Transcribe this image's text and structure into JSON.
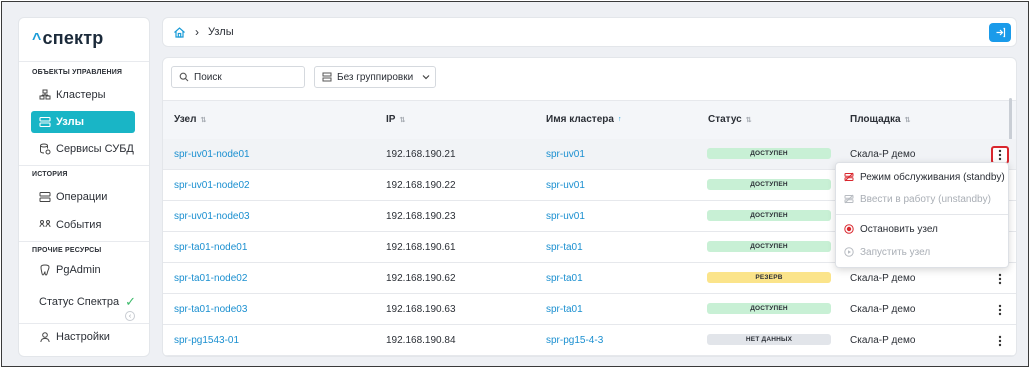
{
  "app": {
    "logo_text": "спектр"
  },
  "sidebar": {
    "section_manage": "ОБЪЕКТЫ УПРАВЛЕНИЯ",
    "section_history": "ИСТОРИЯ",
    "section_other": "ПРОЧИЕ РЕСУРСЫ",
    "items": [
      {
        "label": "Кластеры",
        "icon": "clusters-icon"
      },
      {
        "label": "Узлы",
        "icon": "nodes-icon",
        "active": true
      },
      {
        "label": "Сервисы СУБД",
        "icon": "db-services-icon"
      },
      {
        "label": "Операции",
        "icon": "operations-icon"
      },
      {
        "label": "События",
        "icon": "events-icon"
      },
      {
        "label": "PgAdmin",
        "icon": "pgadmin-icon"
      }
    ],
    "status_label": "Статус Спектра",
    "settings_label": "Настройки"
  },
  "header": {
    "breadcrumb": "Узлы"
  },
  "toolbar": {
    "search_placeholder": "Поиск",
    "grouping_value": "Без группировки"
  },
  "table": {
    "columns": [
      "Узел",
      "IP",
      "Имя кластера",
      "Статус",
      "Площадка"
    ],
    "rows": [
      {
        "node": "spr-uv01-node01",
        "ip": "192.168.190.21",
        "cluster": "spr-uv01",
        "status": "ДОСТУПЕН",
        "status_kind": "ok",
        "site": "Скала-Р демо"
      },
      {
        "node": "spr-uv01-node02",
        "ip": "192.168.190.22",
        "cluster": "spr-uv01",
        "status": "ДОСТУПЕН",
        "status_kind": "ok",
        "site": ""
      },
      {
        "node": "spr-uv01-node03",
        "ip": "192.168.190.23",
        "cluster": "spr-uv01",
        "status": "ДОСТУПЕН",
        "status_kind": "ok",
        "site": ""
      },
      {
        "node": "spr-ta01-node01",
        "ip": "192.168.190.61",
        "cluster": "spr-ta01",
        "status": "ДОСТУПЕН",
        "status_kind": "ok",
        "site": ""
      },
      {
        "node": "spr-ta01-node02",
        "ip": "192.168.190.62",
        "cluster": "spr-ta01",
        "status": "РЕЗЕРВ",
        "status_kind": "reserve",
        "site": "Скала-Р демо"
      },
      {
        "node": "spr-ta01-node03",
        "ip": "192.168.190.63",
        "cluster": "spr-ta01",
        "status": "ДОСТУПЕН",
        "status_kind": "ok",
        "site": "Скала-Р демо"
      },
      {
        "node": "spr-pg1543-01",
        "ip": "192.168.190.84",
        "cluster": "spr-pg15-4-3",
        "status": "НЕТ ДАННЫХ",
        "status_kind": "nodata",
        "site": "Скала-Р демо"
      }
    ]
  },
  "context_menu": {
    "items": [
      {
        "label": "Режим обслуживания (standby)",
        "disabled": false,
        "icon": "maintenance-icon"
      },
      {
        "label": "Ввести в работу (unstandby)",
        "disabled": true,
        "icon": "unstandby-icon"
      },
      {
        "label": "Остановить узел",
        "disabled": false,
        "icon": "stop-icon"
      },
      {
        "label": "Запустить узел",
        "disabled": true,
        "icon": "play-icon"
      }
    ]
  },
  "colors": {
    "accent": "#19b5c6",
    "link": "#1a8fd0",
    "ok_badge": "#c8f0d5",
    "reserve_badge": "#fbe48a",
    "nodata_badge": "#e2e5ea",
    "danger": "#d9272e"
  }
}
